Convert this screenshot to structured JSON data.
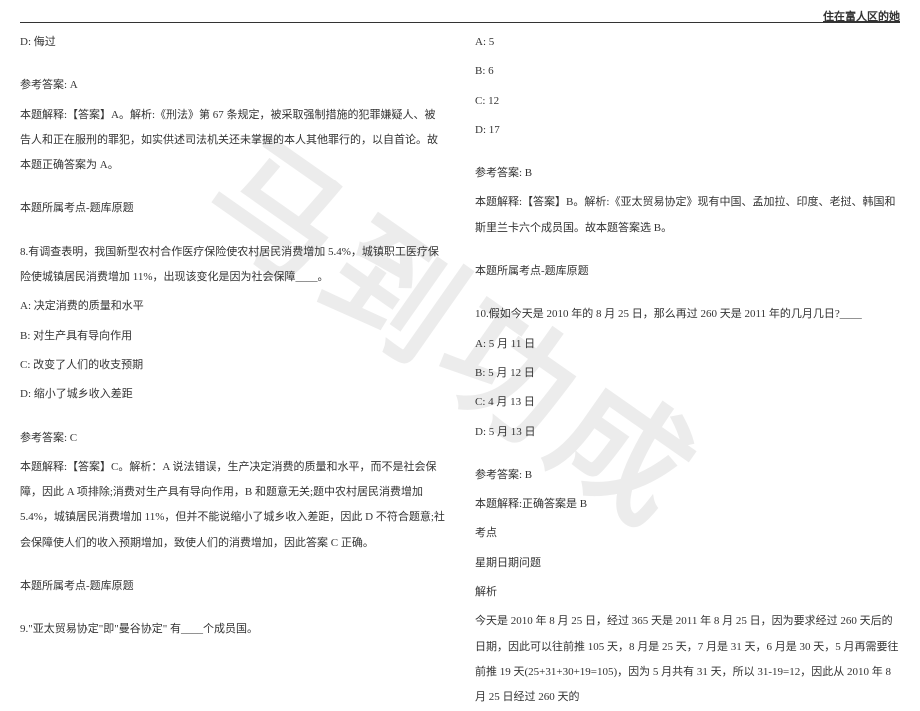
{
  "header": {
    "title": "住在富人区的她"
  },
  "watermark": "马到功成",
  "left_column": {
    "q7_option_d": "D: 侮过",
    "q7_answer_label": "参考答案: A",
    "q7_explanation": "本题解释:【答案】A。解析:《刑法》第 67 条规定，被采取强制措施的犯罪嫌疑人、被告人和正在服刑的罪犯，如实供述司法机关还未掌握的本人其他罪行的，以自首论。故本题正确答案为 A。",
    "q7_source": "本题所属考点-题库原题",
    "q8_stem": "8.有调查表明，我国新型农村合作医疗保险使农村居民消费增加 5.4%，城镇职工医疗保险使城镇居民消费增加 11%，出现该变化是因为社会保障____。",
    "q8_option_a": "A: 决定消费的质量和水平",
    "q8_option_b": "B: 对生产具有导向作用",
    "q8_option_c": "C: 改变了人们的收支预期",
    "q8_option_d": "D: 缩小了城乡收入差距",
    "q8_answer_label": "参考答案: C",
    "q8_explanation": "本题解释:【答案】C。解析：A 说法错误，生产决定消费的质量和水平，而不是社会保障，因此 A 项排除;消费对生产具有导向作用，B 和题意无关;题中农村居民消费增加 5.4%，城镇居民消费增加 11%，但并不能说缩小了城乡收入差距，因此 D 不符合题意;社会保障使人们的收入预期增加，致使人们的消费增加，因此答案 C 正确。",
    "q8_source": "本题所属考点-题库原题",
    "q9_stem": "9.\"亚太贸易协定\"即\"曼谷协定\" 有____个成员国。"
  },
  "right_column": {
    "q9_option_a": "A: 5",
    "q9_option_b": "B: 6",
    "q9_option_c": "C: 12",
    "q9_option_d": "D: 17",
    "q9_answer_label": "参考答案: B",
    "q9_explanation": "本题解释:【答案】B。解析:《亚太贸易协定》现有中国、孟加拉、印度、老挝、韩国和斯里兰卡六个成员国。故本题答案选 B。",
    "q9_source": "本题所属考点-题库原题",
    "q10_stem": "10.假如今天是 2010 年的 8 月 25 日，那么再过 260 天是 2011 年的几月几日?____",
    "q10_option_a": "A: 5 月 11 日",
    "q10_option_b": "B: 5 月 12 日",
    "q10_option_c": "C: 4 月 13 日",
    "q10_option_d": "D: 5 月 13 日",
    "q10_answer_label": "参考答案: B",
    "q10_explanation_line1": "本题解释:正确答案是 B",
    "q10_explanation_line2": "考点",
    "q10_explanation_line3": "星期日期问题",
    "q10_explanation_line4": "解析",
    "q10_explanation_line5": "今天是 2010 年 8 月 25 日，经过 365 天是 2011 年 8 月 25 日，因为要求经过 260 天后的日期，因此可以往前推 105 天，8 月是 25 天，7 月是 31 天，6 月是 30 天，5 月再需要往前推 19 天(25+31+30+19=105)，因为 5 月共有 31 天，所以 31-19=12，因此从 2010 年 8 月 25 日经过 260 天的"
  }
}
